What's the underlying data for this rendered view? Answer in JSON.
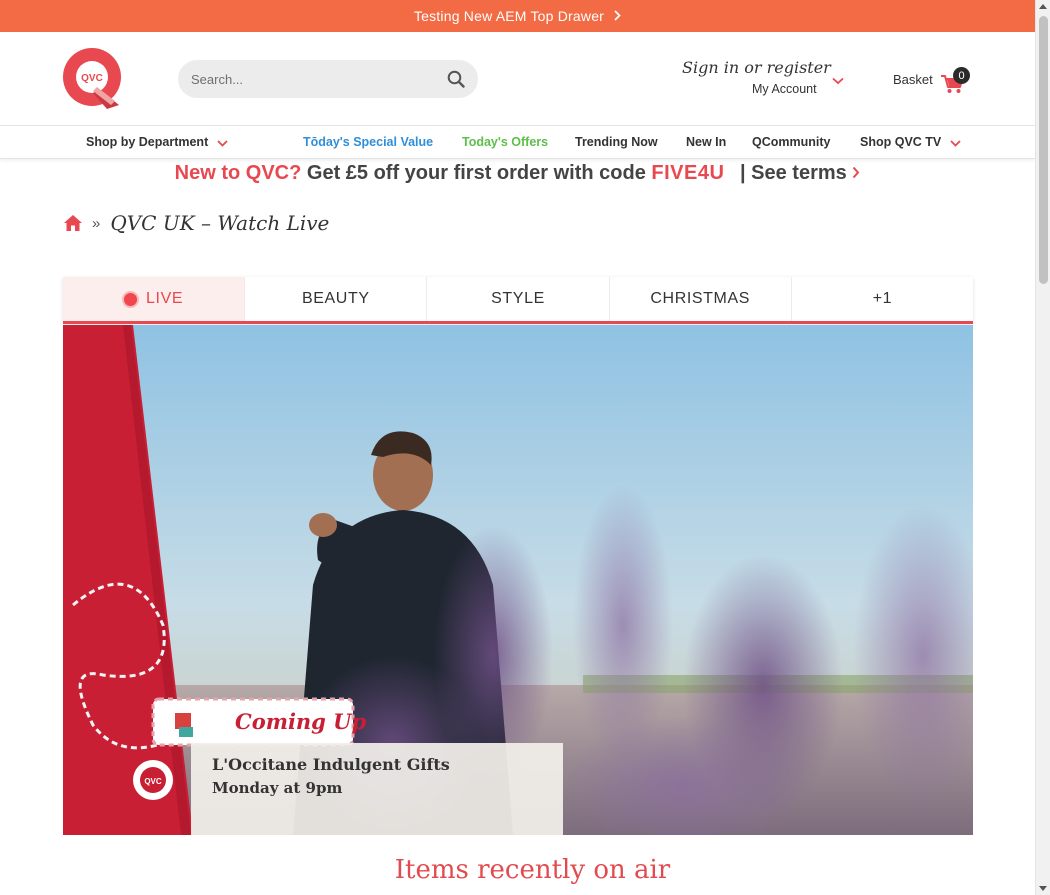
{
  "top_drawer": {
    "text": "Testing New AEM Top Drawer"
  },
  "logo": {
    "text": "QVC"
  },
  "search": {
    "placeholder": "Search..."
  },
  "account": {
    "signin": "Sign in or register",
    "my_account": "My Account"
  },
  "basket": {
    "label": "Basket",
    "count": "0"
  },
  "nav": {
    "shop_by_department": "Shop by Department",
    "special_value": "Tōday's Special Value",
    "todays_offers": "Today's Offers",
    "trending": "Trending Now",
    "new_in": "New In",
    "qcommunity": "QCommunity",
    "shop_qvc_tv": "Shop QVC TV"
  },
  "promo": {
    "lead": "New to QVC?",
    "body": "Get £5 off your first order with code",
    "code": "FIVE4U",
    "terms": "| See terms"
  },
  "breadcrumb": {
    "separator": "»",
    "title": "QVC UK – Watch Live"
  },
  "tabs": [
    {
      "label": "LIVE"
    },
    {
      "label": "BEAUTY"
    },
    {
      "label": "STYLE"
    },
    {
      "label": "CHRISTMAS"
    },
    {
      "label": "+1"
    }
  ],
  "video": {
    "banner_title": "Coming Up",
    "show_title": "L'Occitane Indulgent Gifts",
    "show_time": "Monday at 9pm",
    "badge_text": "QVC"
  },
  "recent": {
    "title": "Items recently on air"
  },
  "colors": {
    "brand_orange": "#f26b44",
    "brand_red": "#e8484f",
    "special_value_blue": "#2f8fd9",
    "offers_green": "#5cc04a"
  }
}
